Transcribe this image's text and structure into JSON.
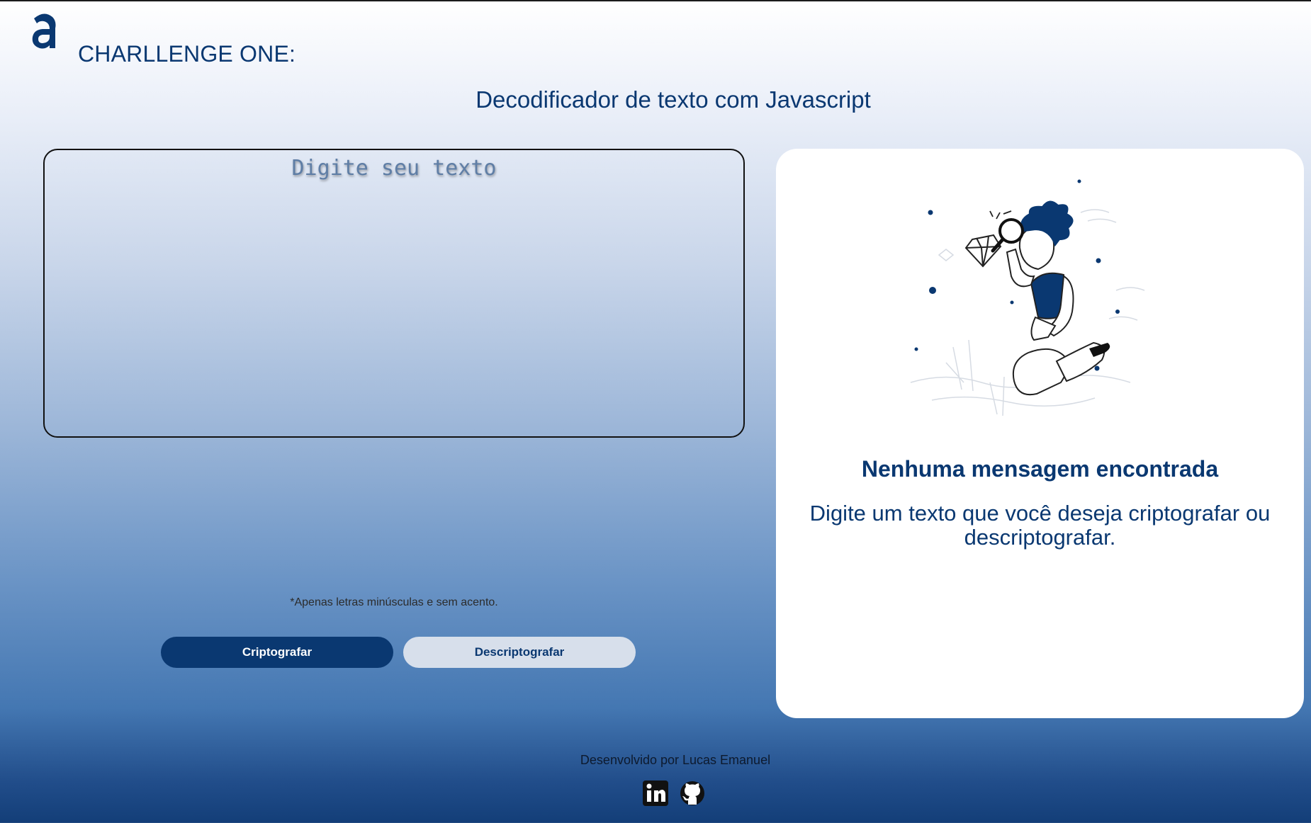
{
  "header": {
    "logo_icon": "alura-logo-icon",
    "brand_title": "CHARLLENGE ONE:",
    "subtitle": "Decodificador de texto com Javascript"
  },
  "editor": {
    "placeholder": "Digite seu texto",
    "value": "",
    "hint": "*Apenas letras minúsculas e sem acento."
  },
  "actions": {
    "encrypt_label": "Criptografar",
    "decrypt_label": "Descriptografar"
  },
  "output": {
    "illustration": "person-with-magnifying-glass-illustration",
    "title": "Nenhuma mensagem encontrada",
    "message": "Digite um texto que você deseja criptografar ou descriptografar."
  },
  "footer": {
    "credit": "Desenvolvido por Lucas Emanuel",
    "icons": [
      "linkedin-icon",
      "github-icon"
    ]
  },
  "colors": {
    "primary": "#0a3871",
    "secondary_button": "#d7dfeb",
    "panel": "#ffffff"
  }
}
